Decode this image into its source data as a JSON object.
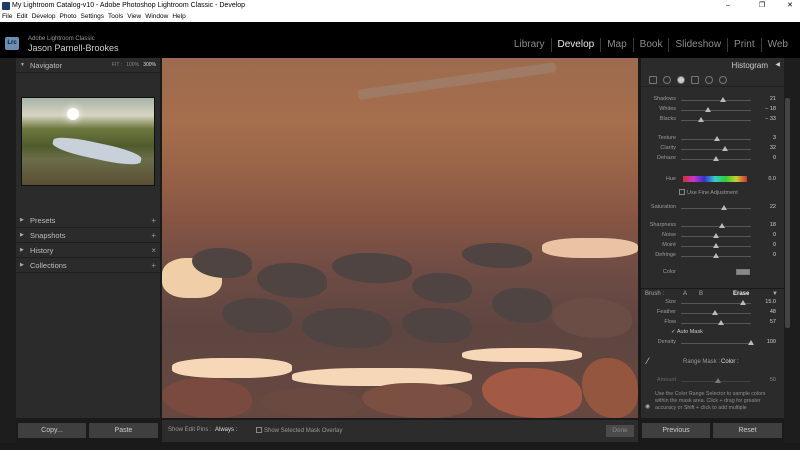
{
  "window": {
    "title": "My Lightroom Catalog-v10 - Adobe Photoshop Lightroom Classic - Develop",
    "controls": [
      "–",
      "❐",
      "✕"
    ]
  },
  "menu": [
    "File",
    "Edit",
    "Develop",
    "Photo",
    "Settings",
    "Tools",
    "View",
    "Window",
    "Help"
  ],
  "identity": {
    "badge": "Lrc",
    "product": "Adobe Lightroom Classic",
    "user": "Jason Parnell-Brookes"
  },
  "modules": [
    "Library",
    "Develop",
    "Map",
    "Book",
    "Slideshow",
    "Print",
    "Web"
  ],
  "active_module": "Develop",
  "left_panel": {
    "navigator": "Navigator",
    "zoom": {
      "fit": "FIT :",
      "p100": "100%",
      "p300": "300%"
    },
    "sections": [
      "Presets",
      "Snapshots",
      "History",
      "Collections"
    ]
  },
  "left_buttons": {
    "copy": "Copy...",
    "paste": "Paste"
  },
  "toolbar": {
    "show_edit_pins": "Show Edit Pins :",
    "pins_value": "Always :",
    "show_mask_overlay": "Show Selected Mask Overlay",
    "done": "Done"
  },
  "right_panel": {
    "histogram": "Histogram",
    "sliders_tone": [
      {
        "label": "Shadows",
        "value": "21"
      },
      {
        "label": "Whites",
        "value": "– 18"
      },
      {
        "label": "Blacks",
        "value": "– 33"
      }
    ],
    "sliders_presence": [
      {
        "label": "Texture",
        "value": "3"
      },
      {
        "label": "Clarity",
        "value": "32"
      },
      {
        "label": "Dehaze",
        "value": "0"
      }
    ],
    "hue": {
      "label": "Hue",
      "value": "0.0",
      "fine": "Use Fine Adjustment"
    },
    "saturation": {
      "label": "Saturation",
      "value": "22"
    },
    "sliders_detail": [
      {
        "label": "Sharpness",
        "value": "18"
      },
      {
        "label": "Noise",
        "value": "0"
      },
      {
        "label": "Moiré",
        "value": "0"
      },
      {
        "label": "Defringe",
        "value": "0"
      }
    ],
    "color_label": "Color",
    "brush": {
      "label": "Brush :",
      "a": "A",
      "b": "B",
      "erase": "Erase",
      "size": {
        "label": "Size",
        "value": "15.0"
      },
      "feather": {
        "label": "Feather",
        "value": "48"
      },
      "flow": {
        "label": "Flow",
        "value": "57"
      },
      "auto_mask": "Auto Mask",
      "density": {
        "label": "Density",
        "value": "100"
      }
    },
    "range_mask": {
      "label": "Range Mask :",
      "value": "Color :"
    },
    "amount": {
      "label": "Amount",
      "value": "50"
    },
    "info": "Use the Color Range Selector to sample colors within the mask area. Click + drag for greater accuracy or Shift + click to add multiple"
  },
  "right_buttons": {
    "previous": "Previous",
    "reset": "Reset"
  },
  "colors": {
    "accent": "#e8e8e8",
    "panel": "#2b2b2b",
    "photo_tint": "#9d6b4f"
  }
}
